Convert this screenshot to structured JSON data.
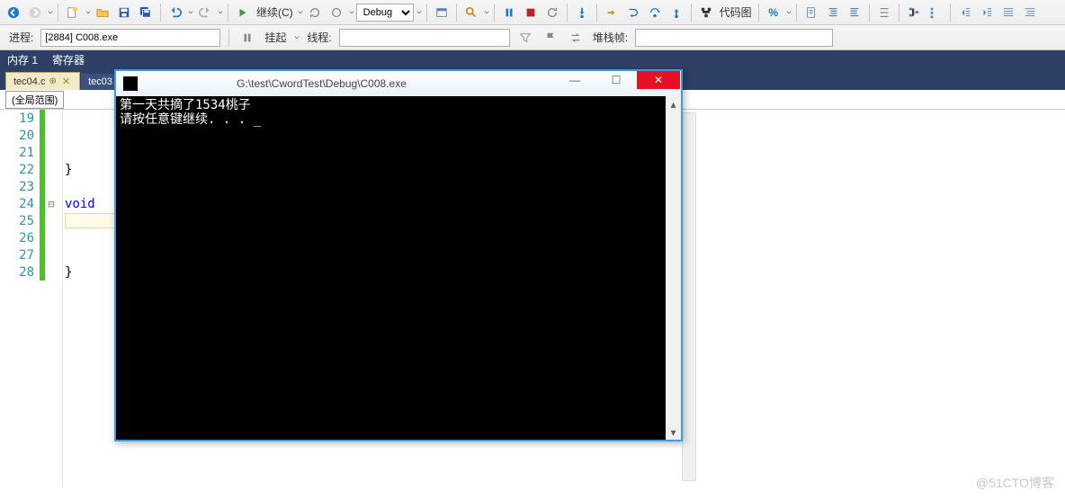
{
  "toolbar": {
    "continue_label": "继续(C)",
    "debug_label": "Debug",
    "codemap_label": "代码图"
  },
  "toolbar2": {
    "process_label": "进程:",
    "process_value": "[2884] C008.exe",
    "suspend_label": "挂起",
    "thread_label": "线程:",
    "stackframe_label": "堆栈帧:"
  },
  "memtabs": {
    "mem1": "内存 1",
    "registers": "寄存器"
  },
  "filetabs": {
    "tab1": {
      "name": "tec04.c"
    },
    "tab2": {
      "name": "tec03"
    }
  },
  "scope": {
    "global": "(全局范围)"
  },
  "code": {
    "lines": [
      {
        "n": "19",
        "txt": ""
      },
      {
        "n": "20",
        "txt": ""
      },
      {
        "n": "21",
        "txt": ""
      },
      {
        "n": "22",
        "txt": "}"
      },
      {
        "n": "23",
        "txt": ""
      },
      {
        "n": "24",
        "txt": "void",
        "fold": "⊟"
      },
      {
        "n": "25",
        "txt": "",
        "current": true
      },
      {
        "n": "26",
        "txt": ""
      },
      {
        "n": "27",
        "txt": ""
      },
      {
        "n": "28",
        "txt": "}"
      }
    ]
  },
  "console": {
    "title": "G:\\test\\CwordTest\\Debug\\C008.exe",
    "line1": "第一天共摘了1534桃子",
    "line2": "请按任意键继续. . . ",
    "cursor": "_"
  },
  "watermark": "@51CTO博客"
}
